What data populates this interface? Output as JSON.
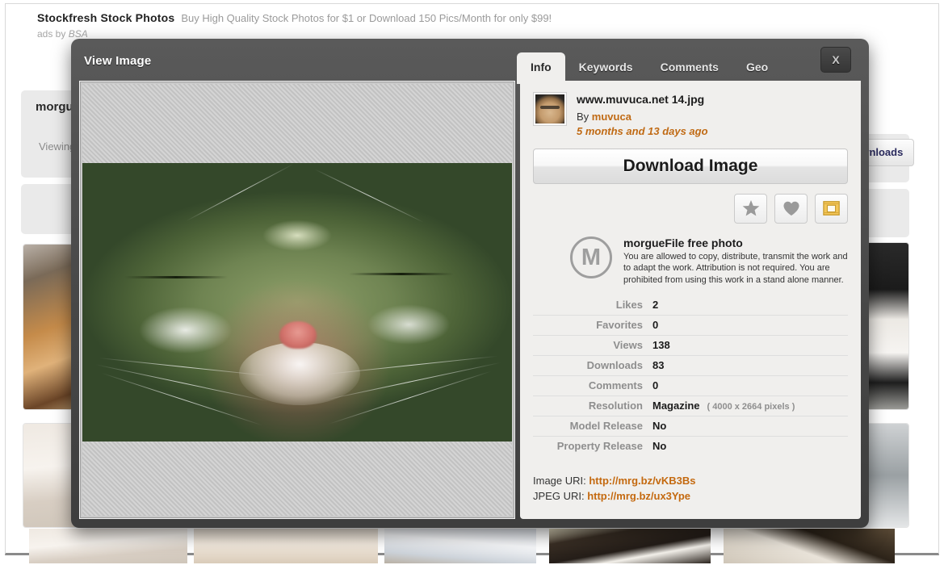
{
  "ad": {
    "title": "Stockfresh Stock Photos",
    "description": "Buy High Quality Stock Photos for $1 or Download 150 Pics/Month for only $99!",
    "by_prefix": "ads by ",
    "by_brand": "BSA"
  },
  "background": {
    "site_title": "morgueFile",
    "viewing_label": "Viewing",
    "downloads_button": "Downloads"
  },
  "modal": {
    "title": "View Image",
    "close_label": "X",
    "tabs": [
      {
        "label": "Info",
        "active": true
      },
      {
        "label": "Keywords",
        "active": false
      },
      {
        "label": "Comments",
        "active": false
      },
      {
        "label": "Geo",
        "active": false
      }
    ]
  },
  "info": {
    "filename": "www.muvuca.net 14.jpg",
    "by_prefix": "By ",
    "author": "muvuca",
    "uploaded_ago": "5 months and 13 days ago",
    "download_button": "Download Image",
    "actions": [
      {
        "name": "star-icon",
        "glyph": "★"
      },
      {
        "name": "heart-icon",
        "glyph": "♥"
      },
      {
        "name": "frame-icon",
        "glyph": "▣"
      }
    ],
    "license": {
      "badge": "M",
      "title": "morgueFile free photo",
      "body": "You are allowed to copy, distribute, transmit the work and to adapt the work. Attribution is not required. You are prohibited from using this work in a stand alone manner."
    },
    "stats": [
      {
        "label": "Likes",
        "value": "2",
        "note": ""
      },
      {
        "label": "Favorites",
        "value": "0",
        "note": ""
      },
      {
        "label": "Views",
        "value": "138",
        "note": ""
      },
      {
        "label": "Downloads",
        "value": "83",
        "note": ""
      },
      {
        "label": "Comments",
        "value": "0",
        "note": ""
      },
      {
        "label": "Resolution",
        "value": "Magazine",
        "note": "( 4000 x 2664 pixels )"
      },
      {
        "label": "Model Release",
        "value": "No",
        "note": ""
      },
      {
        "label": "Property Release",
        "value": "No",
        "note": ""
      }
    ],
    "uris": [
      {
        "label": "Image URI: ",
        "url": "http://mrg.bz/vKB3Bs"
      },
      {
        "label": "JPEG URI: ",
        "url": "http://mrg.bz/ux3Ype"
      }
    ]
  },
  "colors": {
    "accent_orange": "#c06a14",
    "modal_chrome": "#474747",
    "panel_bg": "#f0efed",
    "label_grey": "#8e8e8e"
  }
}
